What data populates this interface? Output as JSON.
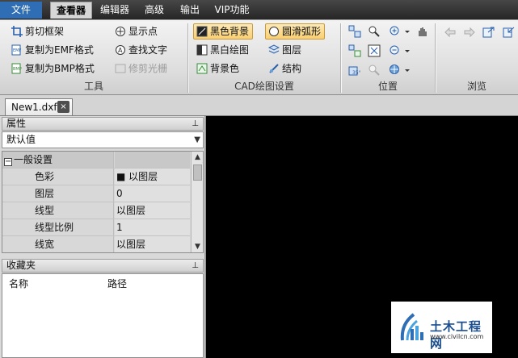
{
  "menubar": {
    "items": [
      "文件",
      "查看器",
      "编辑器",
      "高级",
      "输出",
      "VIP功能"
    ],
    "active_index": 1
  },
  "ribbon": {
    "tools_group": {
      "label": "工具",
      "buttons": [
        {
          "label": "剪切框架",
          "icon": "crop-frame-icon",
          "enabled": true
        },
        {
          "label": "复制为EMF格式",
          "icon": "copy-emf-icon",
          "enabled": true
        },
        {
          "label": "复制为BMP格式",
          "icon": "copy-bmp-icon",
          "enabled": true
        },
        {
          "label": "显示点",
          "icon": "show-points-icon",
          "enabled": true
        },
        {
          "label": "查找文字",
          "icon": "find-text-icon",
          "enabled": true
        },
        {
          "label": "修剪光栅",
          "icon": "trim-raster-icon",
          "enabled": false
        }
      ]
    },
    "cad_group": {
      "label": "CAD绘图设置",
      "buttons": [
        {
          "label": "黑色背景",
          "icon": "black-background-icon",
          "highlighted": true
        },
        {
          "label": "黑白绘图",
          "icon": "black-white-icon",
          "highlighted": false
        },
        {
          "label": "背景色",
          "icon": "background-color-icon",
          "highlighted": false
        },
        {
          "label": "圆滑弧形",
          "icon": "smooth-arc-icon",
          "highlighted": true
        },
        {
          "label": "图层",
          "icon": "layers-icon",
          "highlighted": false
        },
        {
          "label": "结构",
          "icon": "structure-icon",
          "highlighted": false
        }
      ]
    },
    "position_group": {
      "label": "位置"
    },
    "browse_group": {
      "label": "浏览"
    }
  },
  "doc_tabs": [
    {
      "label": "New1.dxf",
      "close": "×"
    }
  ],
  "properties_panel": {
    "title": "属性",
    "pin": "⊥",
    "combo_value": "默认值",
    "category": "一般设置",
    "rows": [
      {
        "name": "色彩",
        "value": "■ 以图层"
      },
      {
        "name": "图层",
        "value": "0"
      },
      {
        "name": "线型",
        "value": "以图层"
      },
      {
        "name": "线型比例",
        "value": "1"
      },
      {
        "name": "线宽",
        "value": "以图层"
      }
    ]
  },
  "favorites_panel": {
    "title": "收藏夹",
    "pin": "⊥",
    "columns": [
      "名称",
      "路径"
    ]
  },
  "watermark": {
    "name": "土木工程网",
    "url": "www.civilcn.com"
  },
  "colors": {
    "menubar": "#2b2b2b",
    "file_menu": "#2f6db5",
    "highlight": "#f9cf72",
    "canvas": "#000000"
  }
}
